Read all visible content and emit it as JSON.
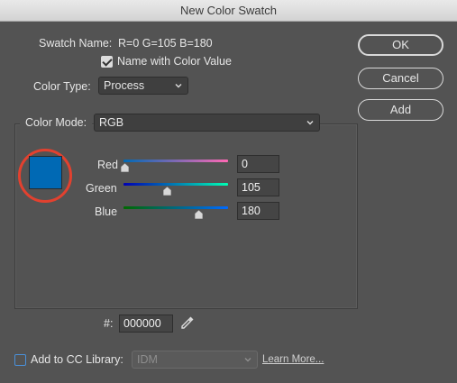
{
  "window": {
    "title": "New Color Swatch"
  },
  "swatch": {
    "name_label": "Swatch Name:",
    "name_value": "R=0 G=105 B=180",
    "name_with_color_label": "Name with Color Value",
    "name_with_color_checked": true
  },
  "color_type": {
    "label": "Color Type:",
    "value": "Process"
  },
  "color_mode": {
    "label": "Color Mode:",
    "value": "RGB"
  },
  "preview_color": "#0069b4",
  "channels": [
    {
      "label": "Red",
      "value": "0",
      "fraction": 0.0,
      "track_colors": [
        "#0069b4",
        "#ff69b4"
      ]
    },
    {
      "label": "Green",
      "value": "105",
      "fraction": 0.41,
      "track_colors": [
        "#0000b4",
        "#00ffb4"
      ]
    },
    {
      "label": "Blue",
      "value": "180",
      "fraction": 0.71,
      "track_colors": [
        "#006900",
        "#0069ff"
      ]
    }
  ],
  "hex": {
    "label": "#:",
    "value": "000000"
  },
  "buttons": {
    "ok": "OK",
    "cancel": "Cancel",
    "add": "Add"
  },
  "library": {
    "label": "Add to CC Library:",
    "checked": false,
    "select_value": "IDM",
    "learn_more": "Learn More..."
  },
  "icons": {
    "eyedropper": "eyedropper-icon",
    "chevron": "chevron-down-icon"
  }
}
